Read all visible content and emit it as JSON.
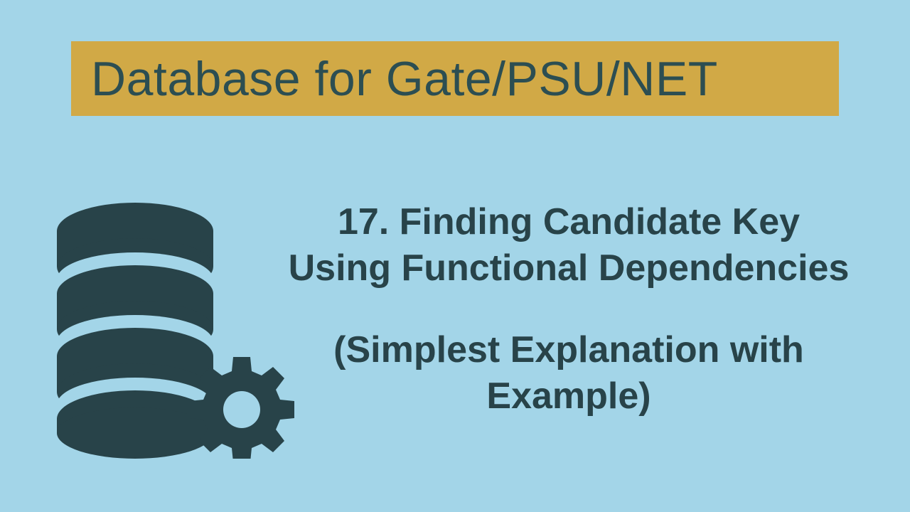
{
  "banner": {
    "title": "Database for Gate/PSU/NET"
  },
  "content": {
    "heading_line1": "17. Finding Candidate Key",
    "heading_line2": "Using Functional Dependencies",
    "subheading_line1": "(Simplest Explanation with",
    "subheading_line2": "Example)"
  },
  "colors": {
    "background": "#a3d5e8",
    "banner_bg": "#d1a946",
    "text_dark": "#2c4e52",
    "icon_color": "#284349"
  }
}
